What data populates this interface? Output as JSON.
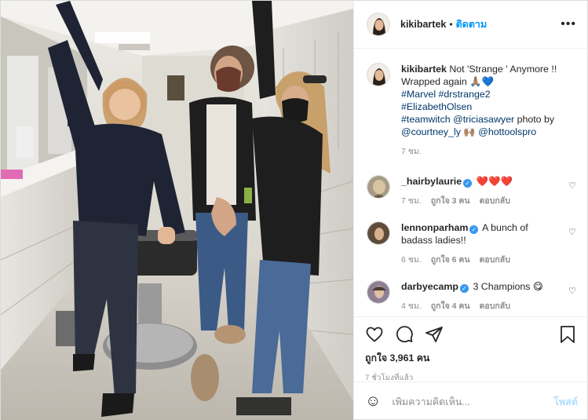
{
  "post": {
    "username": "kikibartek",
    "follow_label": "ติดตาม",
    "more_label": "•••",
    "caption": {
      "username": "kikibartek",
      "text": "Not 'Strange ' Anymore !! Wrapped again 🙏🏽💙",
      "tags_line1": "#Marvel #drstrange2 #ElizabethOlsen",
      "tags_line2_a": "#teamwitch",
      "tags_line2_b": "@triciasawyer",
      "tags_line2_c": " photo by",
      "tags_line3_a": "@courtney_ly",
      "tags_line3_emoji": " 🙌🏽 ",
      "tags_line3_b": "@hottoolspro",
      "time": "7 ชม."
    },
    "comments": [
      {
        "username": "_hairbylaurie",
        "text": "❤️❤️❤️",
        "time": "7 ชม.",
        "likes": "ถูกใจ 3 คน",
        "reply": "ตอบกลับ"
      },
      {
        "username": "lennonparham",
        "text": "A bunch of badass ladies!!",
        "time": "6 ชม.",
        "likes": "ถูกใจ 6 คน",
        "reply": "ตอบกลับ"
      },
      {
        "username": "darbyecamp",
        "text": "3 Champions 😋",
        "time": "4 ชม.",
        "likes": "ถูกใจ 4 คน",
        "reply": "ตอบกลับ"
      }
    ],
    "likes_text": "ถูกใจ 3,961 คน",
    "posted_ago": "7 ชั่วโมงที่แล้ว",
    "add_comment_placeholder": "เพิ่มความคิดเห็น...",
    "post_button": "โพสต์"
  },
  "icons": {
    "like": "heart-icon",
    "comment": "comment-icon",
    "share": "paper-plane-icon",
    "save": "bookmark-icon",
    "emoji": "smiley-icon"
  }
}
